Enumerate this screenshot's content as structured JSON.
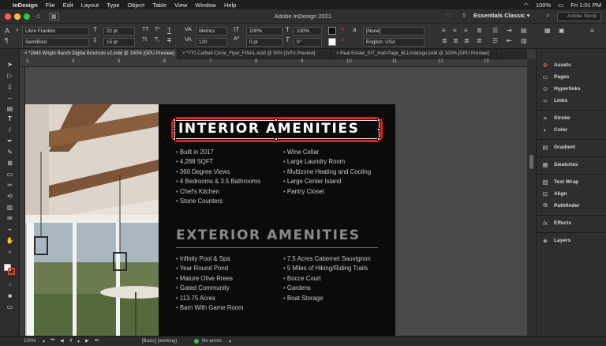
{
  "menubar": {
    "app_name": "InDesign",
    "items": [
      "File",
      "Edit",
      "Layout",
      "Type",
      "Object",
      "Table",
      "View",
      "Window",
      "Help"
    ],
    "battery": "100%",
    "clock": "Fri 1:01 PM"
  },
  "titlebar": {
    "title": "Adobe InDesign 2021",
    "workspace": "Essentials Classic",
    "search_placeholder": "Adobe Stock"
  },
  "control": {
    "font_family": "Libre Franklin",
    "font_style": "SemiBold",
    "font_size": "22 pt",
    "leading": "15 pt",
    "kerning": "Metrics",
    "tracking": "120",
    "vscale": "100%",
    "hscale": "100%",
    "baseline": "0 pt",
    "skew": "0°",
    "char_style": "[None]",
    "language": "English: USA"
  },
  "tabs": [
    "*2843 Wright Ranch Digital Brochure v2.indd @ 100% [GPU Preview]",
    "*770 Carbett Circle_Flyer_FINAL.indd @ 50% [GPU Preview]",
    "Real Estate_SIT_Half-Page_BLLindesign.indd @ 100% [GPU Preview]"
  ],
  "ruler": [
    "3",
    "4",
    "5",
    "6",
    "7",
    "8",
    "9",
    "10",
    "11",
    "12",
    "13"
  ],
  "document": {
    "interior_heading": "INTERIOR AMENITIES",
    "interior_left": [
      "Built in 2017",
      "4,288 SQFT",
      "360 Degree Views",
      "4 Bedrooms & 3.5 Bathrooms",
      "Chef's Kitchen",
      "Stone Counters"
    ],
    "interior_right": [
      "Wine Cellar",
      "Large Laundry Room",
      "Multizone Heating and Cooling",
      "Large Center Island",
      "Pantry Closet"
    ],
    "exterior_heading": "EXTERIOR AMENITIES",
    "exterior_left": [
      "Infinity Pool & Spa",
      "Year Round Pond",
      "Mature Olive Rrees",
      "Gated Community",
      "113.75 Acres",
      "Barn With Game Room"
    ],
    "exterior_right": [
      "7.5 Acres Cabernet Sauvignon",
      "5 Miles of Hiking/Riding Trails",
      "Bocce Court",
      "Gardens",
      "Boat Storage"
    ]
  },
  "panels": [
    {
      "label": "Assets",
      "icon": "assets-icon"
    },
    {
      "label": "Pages",
      "icon": "pages-icon"
    },
    {
      "label": "Hyperlinks",
      "icon": "hyperlinks-icon"
    },
    {
      "label": "Links",
      "icon": "links-icon"
    },
    {
      "label": "Stroke",
      "icon": "stroke-icon"
    },
    {
      "label": "Color",
      "icon": "color-icon"
    },
    {
      "label": "Gradient",
      "icon": "gradient-icon"
    },
    {
      "label": "Swatches",
      "icon": "swatches-icon"
    },
    {
      "label": "Text Wrap",
      "icon": "text-wrap-icon"
    },
    {
      "label": "Align",
      "icon": "align-icon"
    },
    {
      "label": "Pathfinder",
      "icon": "pathfinder-icon"
    },
    {
      "label": "Effects",
      "icon": "effects-icon"
    },
    {
      "label": "Layers",
      "icon": "layers-icon"
    }
  ],
  "status": {
    "zoom": "100%",
    "page": "4",
    "master": "[Basic] (working)",
    "errors": "No errors"
  },
  "colors": {
    "selection_highlight": "#e02020",
    "page_background": "#0b0b0b",
    "heading_white": "#ffffff",
    "heading_grey": "#8a8a8a"
  }
}
